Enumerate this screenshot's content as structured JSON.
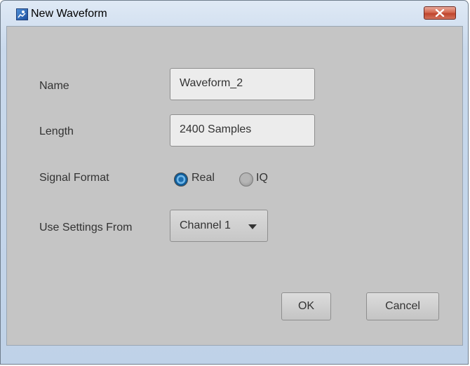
{
  "window": {
    "title": "New Waveform"
  },
  "form": {
    "name_label": "Name",
    "name_value": "Waveform_2",
    "length_label": "Length",
    "length_value": "2400 Samples",
    "signal_format_label": "Signal Format",
    "signal_format_options": [
      {
        "label": "Real",
        "selected": true
      },
      {
        "label": "IQ",
        "selected": false
      }
    ],
    "use_settings_label": "Use Settings From",
    "use_settings_value": "Channel 1"
  },
  "buttons": {
    "ok_label": "OK",
    "cancel_label": "Cancel"
  },
  "icons": {
    "app": "waveform-app-icon",
    "close": "close-icon",
    "dropdown": "chevron-down-icon"
  },
  "colors": {
    "close_button": "#c9533c",
    "radio_selected": "#1d6eb0",
    "client_background": "#c5c5c5"
  }
}
